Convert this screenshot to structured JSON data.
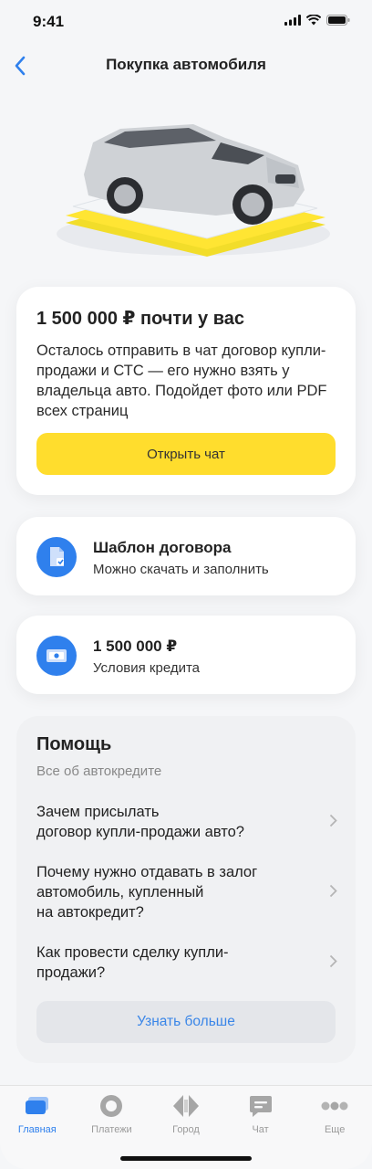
{
  "status_bar": {
    "time": "9:41"
  },
  "nav": {
    "title": "Покупка автомобиля"
  },
  "main_card": {
    "title": "1 500 000 ₽ почти у вас",
    "description": "Осталось отправить в чат договор купли-продажи и СТС — его нужно взять у владельца авто. Подойдет фото или PDF всех страниц",
    "button_label": "Открыть чат"
  },
  "contract_card": {
    "title": "Шаблон договора",
    "subtitle": "Можно скачать и заполнить"
  },
  "credit_card": {
    "title": "1 500 000 ₽",
    "subtitle": "Условия кредита"
  },
  "help": {
    "title": "Помощь",
    "subtitle": "Все об автокредите",
    "items": [
      {
        "text": "Зачем присылать\nдоговор купли-продажи авто?"
      },
      {
        "text": "Почему нужно отдавать в залог\nавтомобиль, купленный\nна автокредит?"
      },
      {
        "text": "Как провести сделку купли-\nпродажи?"
      }
    ],
    "button_label": "Узнать больше"
  },
  "tabs": [
    {
      "label": "Главная",
      "icon": "home-card-icon",
      "active": true
    },
    {
      "label": "Платежи",
      "icon": "payments-icon",
      "active": false
    },
    {
      "label": "Город",
      "icon": "city-icon",
      "active": false
    },
    {
      "label": "Чат",
      "icon": "chat-icon",
      "active": false
    },
    {
      "label": "Еще",
      "icon": "more-icon",
      "active": false
    }
  ],
  "colors": {
    "accent": "#2f80ed",
    "primary_button": "#ffdd2d",
    "link": "#3a86e8",
    "background": "#f5f6f8"
  }
}
